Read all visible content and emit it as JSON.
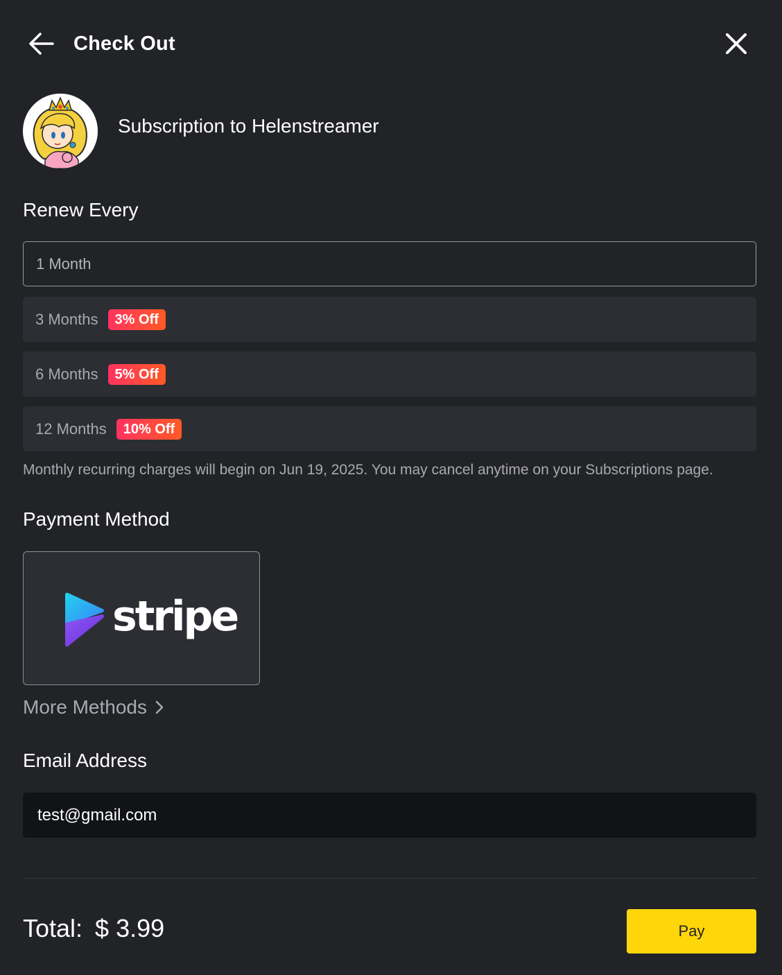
{
  "header": {
    "title": "Check Out",
    "back_icon": "arrow-left-icon",
    "close_icon": "close-icon"
  },
  "creator": {
    "avatar": "princess-peach-avatar",
    "subscription_title": "Subscription to Helenstreamer"
  },
  "renew": {
    "heading": "Renew Every",
    "options": [
      {
        "label": "1 Month",
        "badge": "",
        "selected": true
      },
      {
        "label": "3 Months",
        "badge": "3% Off",
        "selected": false
      },
      {
        "label": "6 Months",
        "badge": "5% Off",
        "selected": false
      },
      {
        "label": "12 Months",
        "badge": "10% Off",
        "selected": false
      }
    ],
    "note": "Monthly recurring charges will begin on Jun 19, 2025. You may cancel anytime on your Subscriptions page."
  },
  "payment": {
    "heading": "Payment Method",
    "method_name": "stripe",
    "more_methods": "More Methods"
  },
  "email": {
    "heading": "Email Address",
    "value": "test@gmail.com"
  },
  "footer": {
    "total_label": "Total:",
    "total_amount": "$ 3.99",
    "pay_label": "Pay"
  },
  "colors": {
    "background": "#222327",
    "option_bg": "#2c2e34",
    "badge_start": "#ff3360",
    "badge_end": "#ff5a26",
    "pay_button": "#ffd60a",
    "input_bg": "#111316"
  }
}
